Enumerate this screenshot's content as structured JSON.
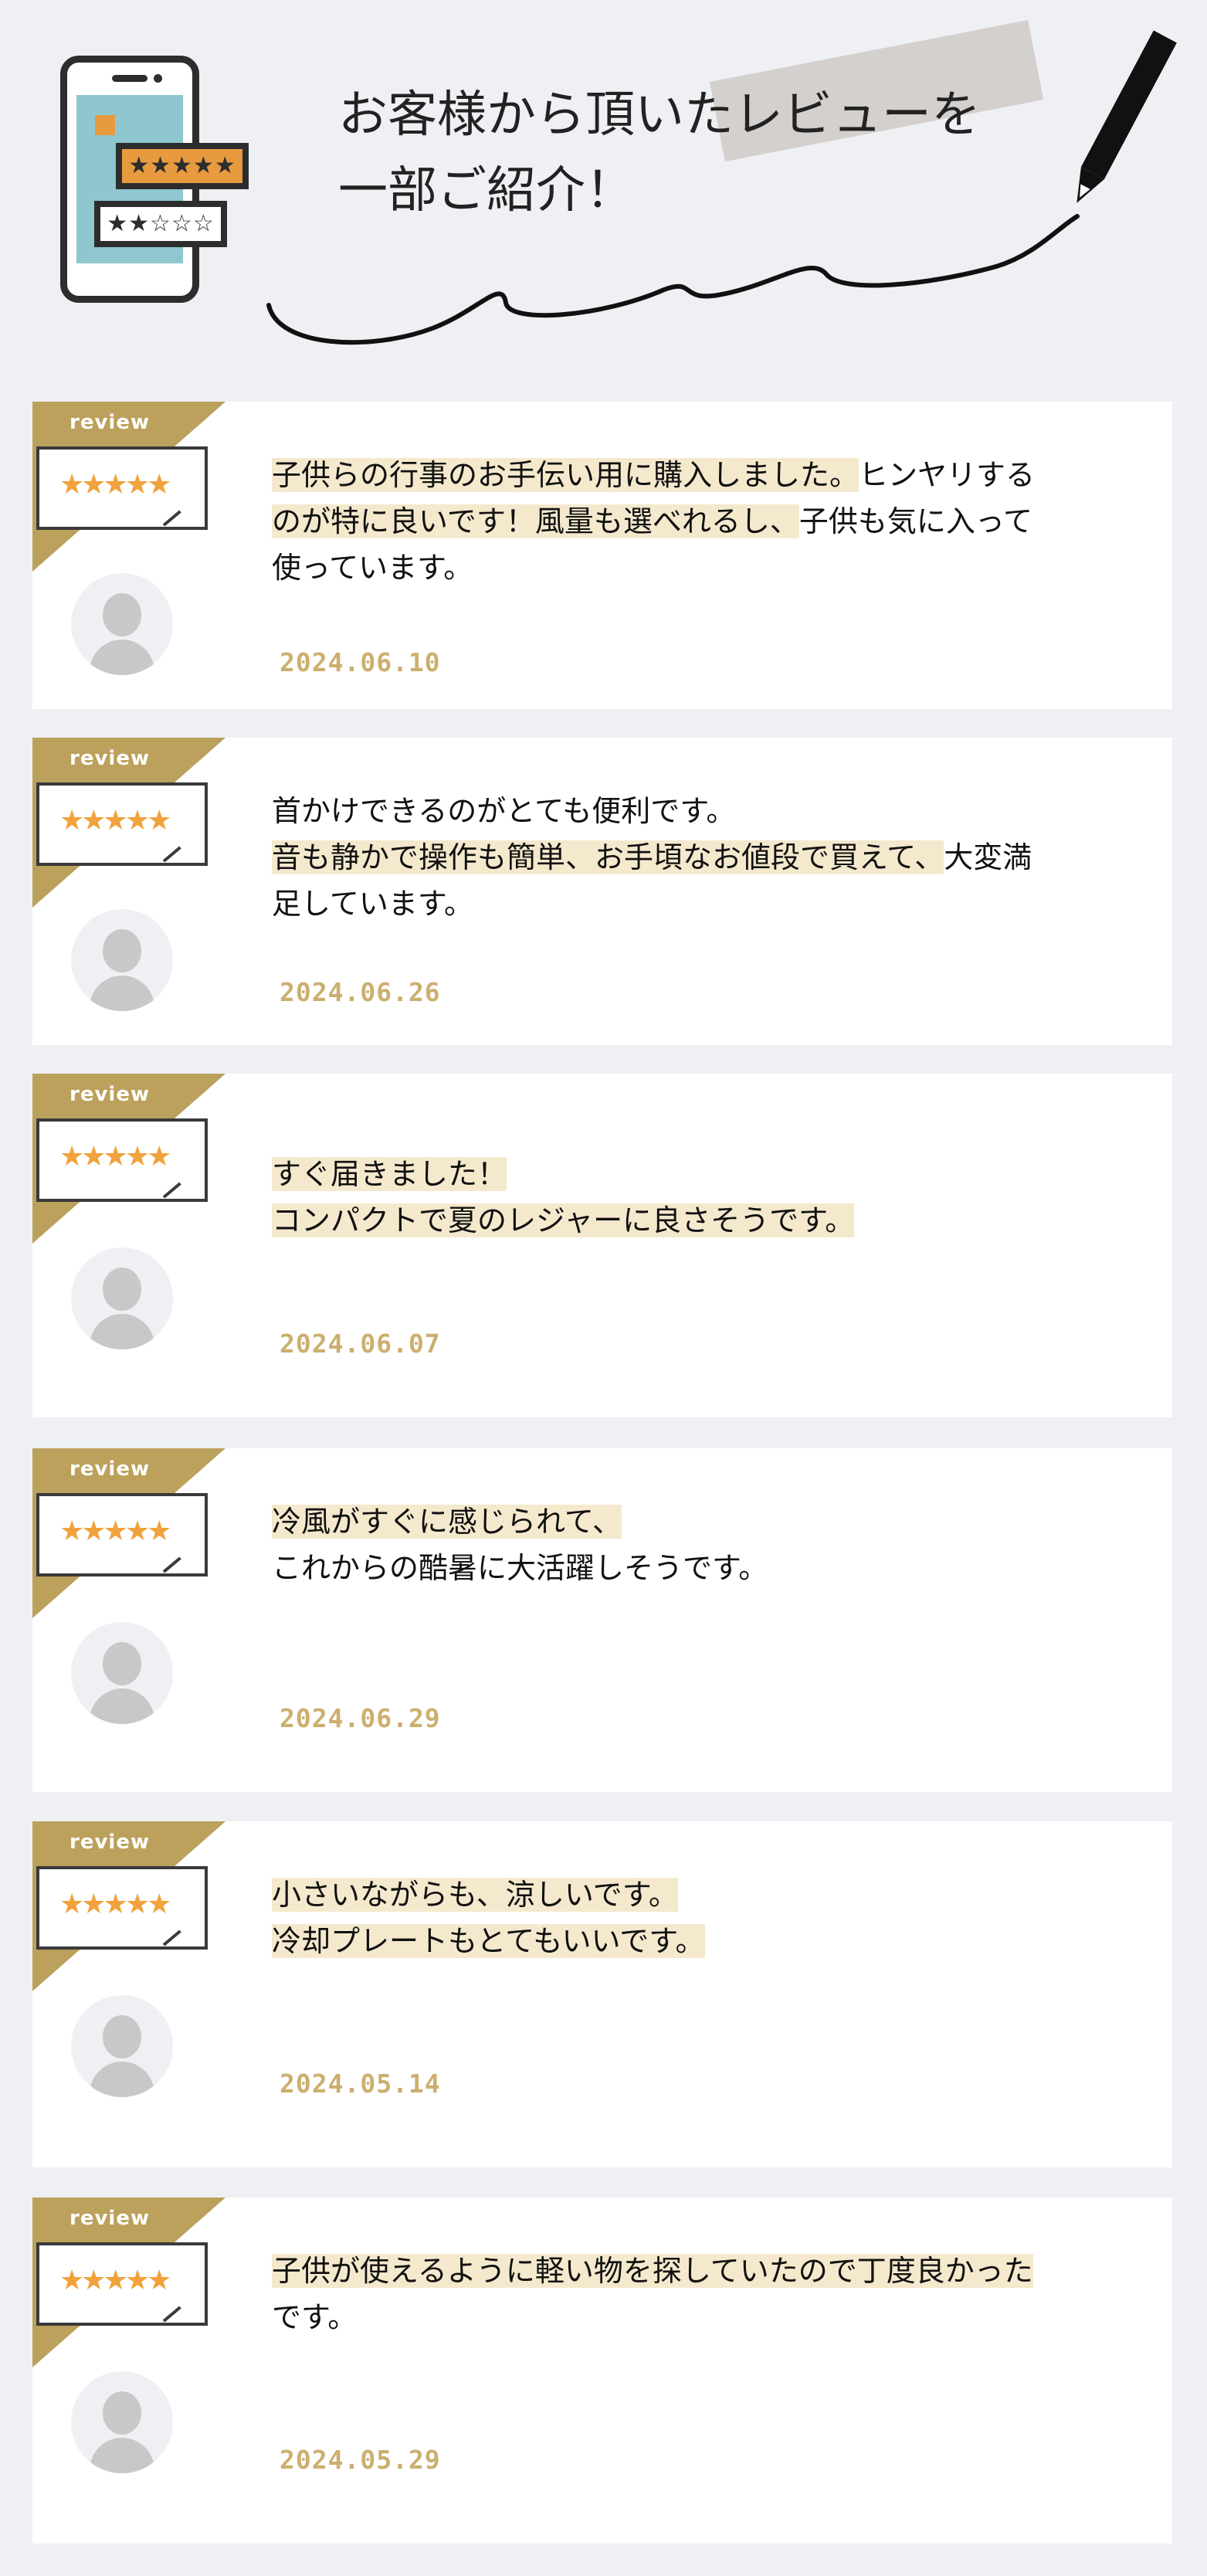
{
  "header": {
    "title_line1": "お客様から頂いたレビューを",
    "title_line2": "一部ご紹介！",
    "icon_badge_stars": "★★★★★",
    "icon_rating_stars": "★★☆☆☆"
  },
  "colors": {
    "background": "#eef0f4",
    "ribbon": "#bba15b",
    "star": "#f1a23b",
    "highlight": "#f4e9cd",
    "date": "#ccaf6f"
  },
  "review_label": "review",
  "stars": "★★★★★",
  "reviews": [
    {
      "lines": [
        [
          "子供らの行事のお手伝い用に購入しました。",
          "ヒンヤリする"
        ],
        [
          "のが特に良いです！風量も選べれるし、",
          "子供も気に入って"
        ],
        [
          "",
          "使っています。"
        ]
      ],
      "date": "2024.06.10"
    },
    {
      "lines": [
        [
          "",
          "首かけできるのがとても便利です。"
        ],
        [
          "音も静かで操作も簡単、お手頃なお値段で買えて、",
          "大変満"
        ],
        [
          "",
          "足しています。"
        ]
      ],
      "date": "2024.06.26"
    },
    {
      "lines": [
        [
          "すぐ届きました！",
          ""
        ],
        [
          "コンパクトで夏のレジャーに良さそうです。",
          ""
        ]
      ],
      "date": "2024.06.07"
    },
    {
      "lines": [
        [
          "冷風がすぐに感じられて、",
          ""
        ],
        [
          "",
          "これからの酷暑に大活躍しそうです。"
        ]
      ],
      "date": "2024.06.29"
    },
    {
      "lines": [
        [
          "小さいながらも、涼しいです。",
          ""
        ],
        [
          "冷却プレートもとてもいいです。",
          ""
        ]
      ],
      "date": "2024.05.14"
    },
    {
      "lines": [
        [
          "子供が使えるように軽い物を探していたので丁度良かった",
          ""
        ],
        [
          "",
          "です。"
        ]
      ],
      "date": "2024.05.29"
    }
  ]
}
